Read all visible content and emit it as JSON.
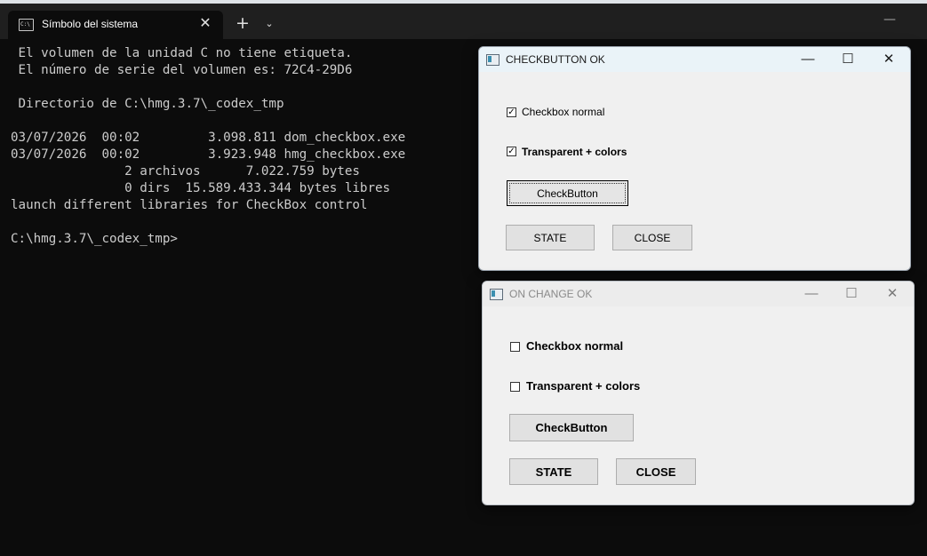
{
  "terminal": {
    "tab_title": "Símbolo del sistema",
    "lines": [
      " El volumen de la unidad C no tiene etiqueta.",
      " El número de serie del volumen es: 72C4-29D6",
      "",
      " Directorio de C:\\hmg.3.7\\_codex_tmp",
      "",
      "03/07/2026  00:02         3.098.811 dom_checkbox.exe",
      "03/07/2026  00:02         3.923.948 hmg_checkbox.exe",
      "               2 archivos      7.022.759 bytes",
      "               0 dirs  15.589.433.344 bytes libres",
      "launch different libraries for CheckBox control",
      "",
      "C:\\hmg.3.7\\_codex_tmp>"
    ],
    "icons": {
      "tab": "cmd-icon",
      "close": "close-icon",
      "new_tab": "plus-icon",
      "dropdown": "chevron-down-icon",
      "minimize": "minimize-icon"
    }
  },
  "window1": {
    "title": "CHECKBUTTON OK",
    "checkbox1": {
      "label": "Checkbox normal",
      "checked": true
    },
    "checkbox2": {
      "label": "Transparent + colors",
      "checked": true
    },
    "checkbutton_label": "CheckButton",
    "state_label": "STATE",
    "close_label": "CLOSE"
  },
  "window2": {
    "title": "ON CHANGE OK",
    "checkbox1": {
      "label": "Checkbox normal",
      "checked": false
    },
    "checkbox2": {
      "label": "Transparent + colors",
      "checked": false
    },
    "checkbutton_label": "CheckButton",
    "state_label": "STATE",
    "close_label": "CLOSE"
  },
  "glyphs": {
    "close": "✕",
    "plus": "+",
    "chevron": "⌄",
    "minimize": "—",
    "maximize": "☐",
    "check": "✓"
  }
}
